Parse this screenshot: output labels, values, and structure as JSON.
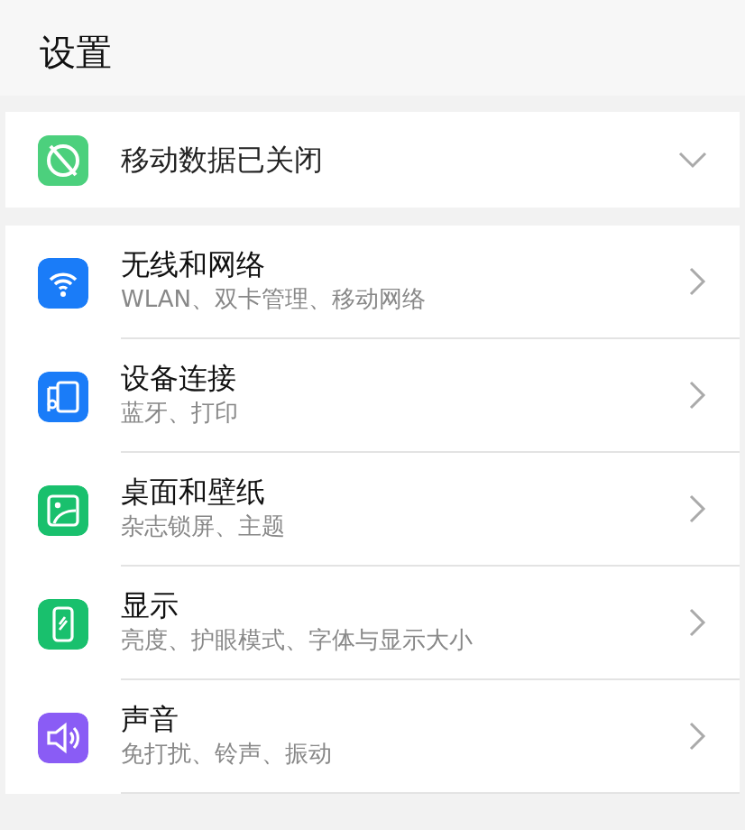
{
  "title": "设置",
  "mobile_data": {
    "label": "移动数据已关闭",
    "expanded": false
  },
  "items": [
    {
      "kind": "wifi",
      "color": "#1a7cf8",
      "title": "无线和网络",
      "subtitle": "WLAN、双卡管理、移动网络"
    },
    {
      "kind": "device",
      "color": "#1a7cf8",
      "title": "设备连接",
      "subtitle": "蓝牙、打印"
    },
    {
      "kind": "wallpaper",
      "color": "#19c06d",
      "title": "桌面和壁纸",
      "subtitle": "杂志锁屏、主题"
    },
    {
      "kind": "display",
      "color": "#19c06d",
      "title": "显示",
      "subtitle": "亮度、护眼模式、字体与显示大小"
    },
    {
      "kind": "sound",
      "color": "#8a5cf5",
      "title": "声音",
      "subtitle": "免打扰、铃声、振动"
    }
  ]
}
